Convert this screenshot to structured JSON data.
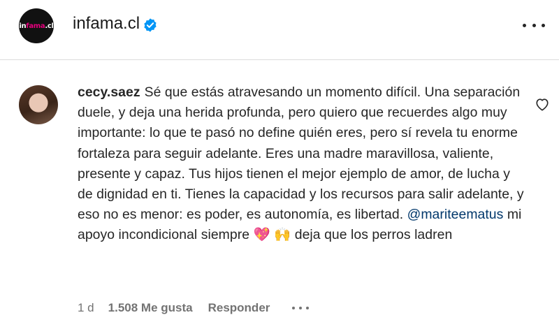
{
  "header": {
    "logo_text_main": "in",
    "logo_text_accent": "fama",
    "logo_text_suffix": ".cl",
    "account_name": "infama.cl",
    "verified": true,
    "more_icon": "more-horizontal-icon"
  },
  "comment": {
    "username": "cecy.saez",
    "text_part1": "Sé que estás atravesando un momento difícil. Una separación duele, y deja una herida profunda, pero quiero que recuerdes algo muy importante: lo que te pasó no define quién eres, pero sí revela tu enorme fortaleza para seguir adelante. Eres una madre maravillosa, valiente, presente y capaz. Tus hijos tienen el mejor ejemplo de amor, de lucha y de dignidad en ti. Tienes la capacidad y los recursos para salir adelante, y eso no es menor: es poder, es autonomía, es libertad.",
    "mention": "@mariteematus",
    "text_part2": " mi apoyo incondicional siempre ",
    "emoji_heart": "💖",
    "emoji_hands": "🙌",
    "text_part3": " deja que los perros ladren",
    "time": "1 d",
    "likes": "1.508 Me gusta",
    "reply_label": "Responder",
    "like_icon": "heart-outline-icon",
    "more_icon": "more-horizontal-icon"
  },
  "colors": {
    "brand_accent": "#e4007c",
    "verified_blue": "#0095f6",
    "mention": "#00376b",
    "secondary_text": "#737373"
  }
}
